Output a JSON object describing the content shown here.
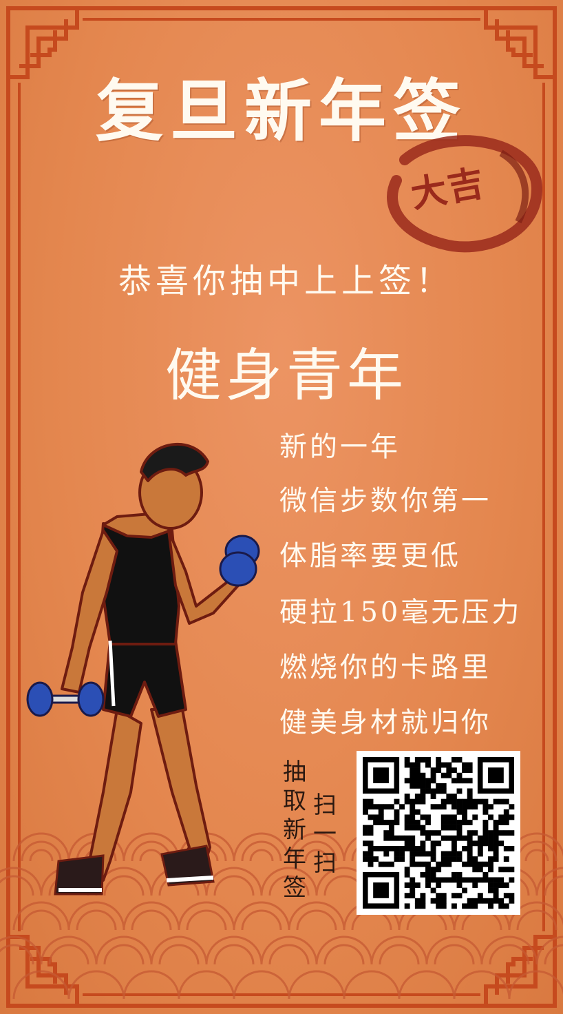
{
  "poster": {
    "title": "复旦新年签",
    "seal_text": "大吉",
    "congrats": "恭喜你抽中上上签！",
    "fortune": "健身青年",
    "verses": [
      "新的一年",
      "微信步数你第一",
      "体脂率要更低",
      "硬拉150毫无压力",
      "燃烧你的卡路里",
      "健美身材就归你"
    ],
    "cta_vertical_left": [
      "抽",
      "取",
      "新",
      "年",
      "签"
    ],
    "cta_vertical_right": [
      "扫",
      "一",
      "扫"
    ],
    "illustration": "weightlifter-with-dumbbells",
    "colors": {
      "background": "#e4874f",
      "frame": "#c64a1e",
      "text": "#fffaf0",
      "seal": "#9a2a1c",
      "waves": "#c65a33"
    }
  }
}
